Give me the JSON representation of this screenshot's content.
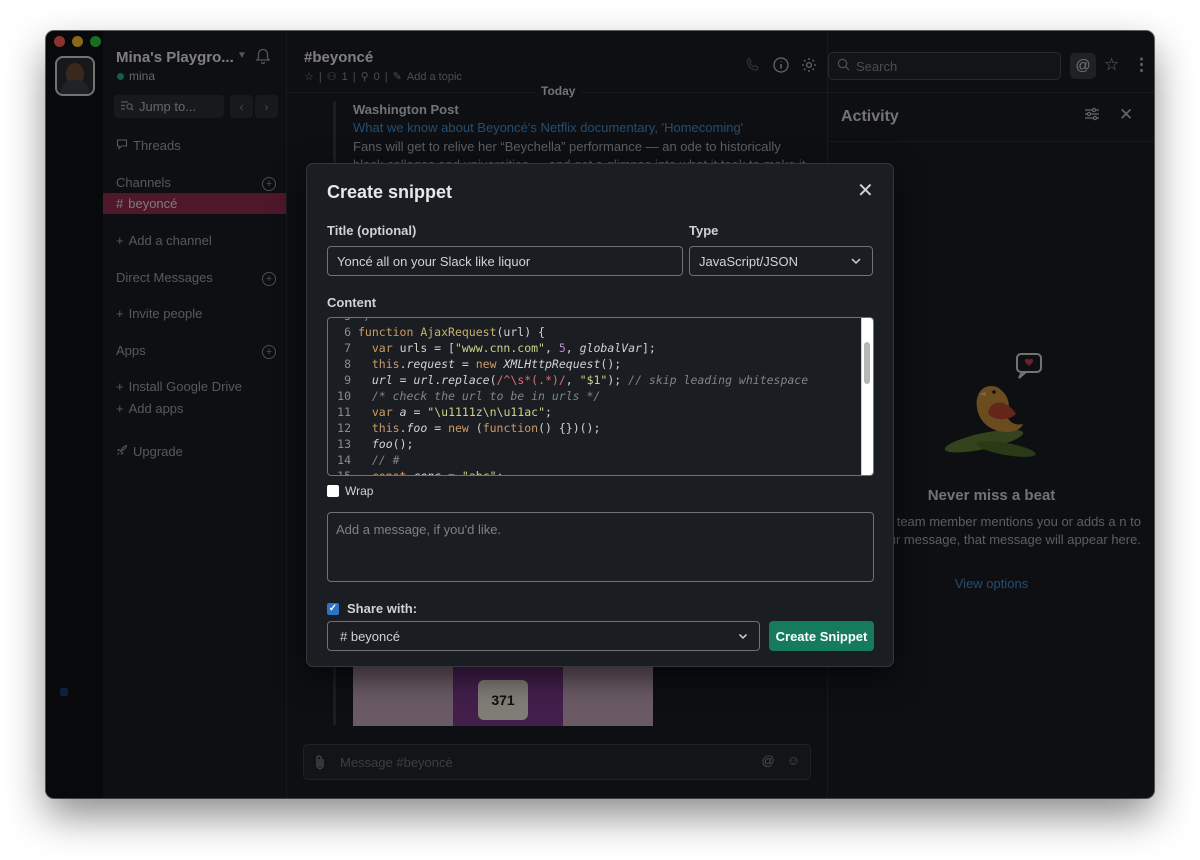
{
  "workspace": {
    "name": "Mina's Playgro...",
    "user": "mina"
  },
  "sidebar": {
    "jump_to": "Jump to...",
    "threads": "Threads",
    "channels_header": "Channels",
    "active_channel": "beyoncé",
    "add_channel": "Add a channel",
    "dm_header": "Direct Messages",
    "invite_people": "Invite people",
    "apps_header": "Apps",
    "install_drive": "Install Google Drive",
    "add_apps": "Add apps",
    "upgrade": "Upgrade"
  },
  "channel": {
    "title": "#beyoncé",
    "members": "1",
    "pins": "0",
    "add_topic": "Add a topic",
    "today": "Today",
    "attachment_source": "Washington Post",
    "attachment_link": "What we know about Beyoncé's Netflix documentary, 'Homecoming'",
    "attachment_text": "Fans will get to relive her “Beychella” performance — an ode to historically black colleges and universities — and get a glimpse into what it took to make it.",
    "photo_number": "371",
    "composer_placeholder": "Message #beyoncé"
  },
  "header": {
    "search_placeholder": "Search"
  },
  "activity": {
    "title": "Activity",
    "empty_title": "Never miss a beat",
    "empty_body": "n a team member mentions you or adds a n to your message, that message will appear here.",
    "view_options": "View options"
  },
  "modal": {
    "title": "Create snippet",
    "title_label": "Title (optional)",
    "title_value": "Yoncé all on your Slack like liquor",
    "type_label": "Type",
    "type_value": "JavaScript/JSON",
    "content_label": "Content",
    "code_lines": [
      {
        "n": "6",
        "t": "function AjaxRequest(url) {"
      },
      {
        "n": "7",
        "t": "  var urls = [\"www.cnn.com\", 5, globalVar];"
      },
      {
        "n": "8",
        "t": "  this.request = new XMLHttpRequest();"
      },
      {
        "n": "9",
        "t": "  url = url.replace(/^\\s*(.*)/, \"$1\"); // skip leading whitespace"
      },
      {
        "n": "10",
        "t": "  /* check the url to be in urls */"
      },
      {
        "n": "11",
        "t": "  var a = \"\\u1111z\\n\\u11ac\";"
      },
      {
        "n": "12",
        "t": "  this.foo = new (function() {})();"
      },
      {
        "n": "13",
        "t": "  foo();"
      },
      {
        "n": "14",
        "t": "  // #"
      }
    ],
    "wrap_label": "Wrap",
    "message_placeholder": "Add a message, if you'd like.",
    "share_label": "Share with:",
    "share_value": "# beyoncé",
    "create_button": "Create Snippet"
  },
  "colors": {
    "accent_active": "#8e2b4e",
    "create_button": "#157b5c",
    "link": "#3e8ecf",
    "presence": "#2bac76"
  }
}
